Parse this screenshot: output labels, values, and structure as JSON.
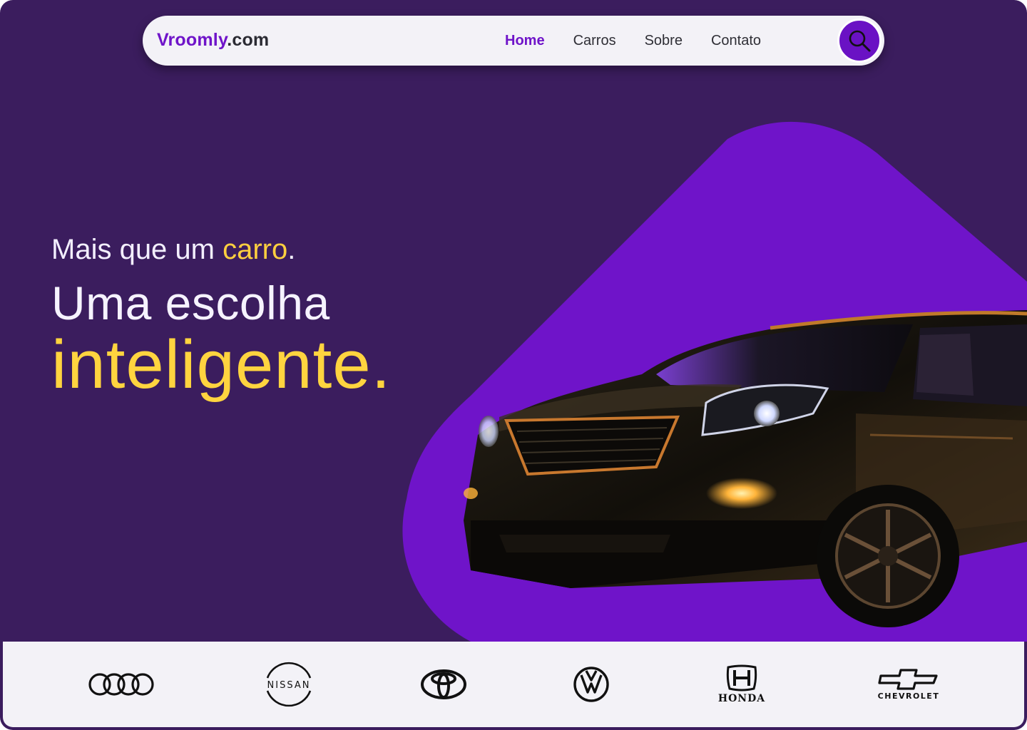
{
  "nav": {
    "logo_brand": "Vroomly",
    "logo_tld": ".com",
    "links": [
      {
        "label": "Home",
        "active": true
      },
      {
        "label": "Carros",
        "active": false
      },
      {
        "label": "Sobre",
        "active": false
      },
      {
        "label": "Contato",
        "active": false
      }
    ],
    "search_icon": "search-icon"
  },
  "hero": {
    "tagline_prefix": "Mais que um ",
    "tagline_highlight": "carro",
    "tagline_suffix": ".",
    "headline": "Uma escolha",
    "headline_emphasis": "inteligente."
  },
  "brands": [
    {
      "name": "Audi",
      "icon": "audi-logo"
    },
    {
      "name": "NISSAN",
      "icon": "nissan-logo"
    },
    {
      "name": "Toyota",
      "icon": "toyota-logo"
    },
    {
      "name": "Volkswagen",
      "icon": "volkswagen-logo"
    },
    {
      "name": "HONDA",
      "icon": "honda-logo"
    },
    {
      "name": "CHEVROLET",
      "icon": "chevrolet-logo"
    }
  ],
  "colors": {
    "background": "#3b1d5e",
    "accent_purple": "#6f14c9",
    "accent_yellow": "#ffd43f",
    "strip": "#f3f2f7"
  }
}
